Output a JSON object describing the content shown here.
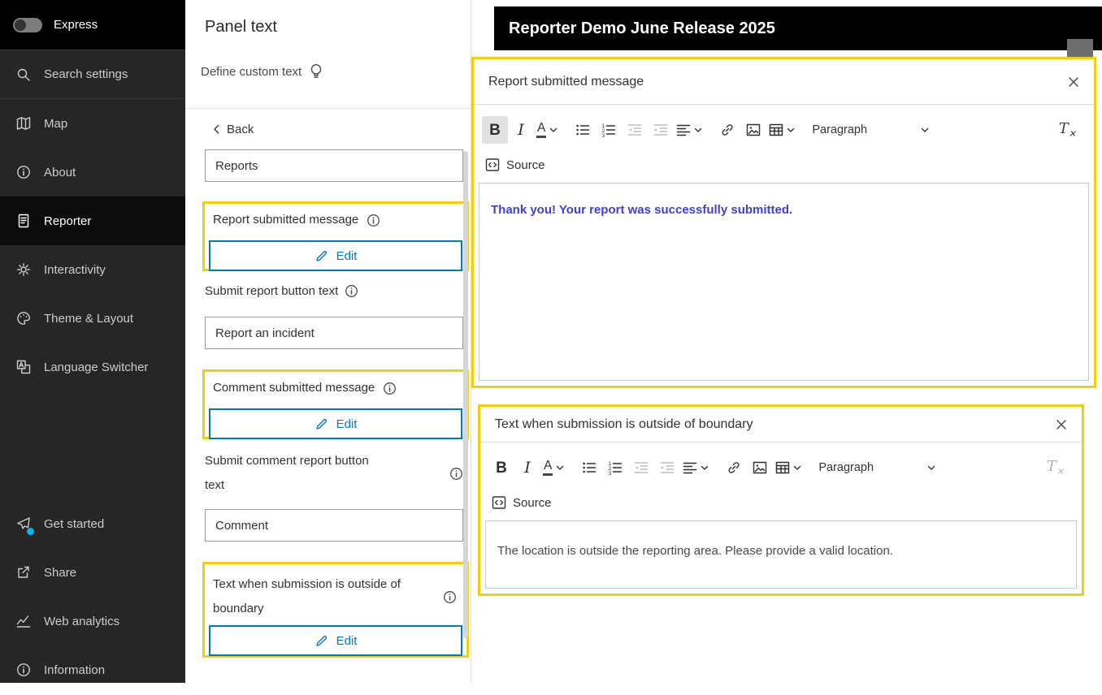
{
  "colors": {
    "highlight": "#F2CE0D",
    "accent": "#0079C1",
    "editor_message_blue": "#3F3FD6",
    "badge_blue": "#00B7F1"
  },
  "sidebar": {
    "express": {
      "label": "Express",
      "toggle_on": false
    },
    "items": [
      {
        "label": "Search settings",
        "icon": "search"
      },
      {
        "label": "Map",
        "icon": "map"
      },
      {
        "label": "About",
        "icon": "info"
      },
      {
        "label": "Reporter",
        "icon": "report",
        "selected": true
      },
      {
        "label": "Interactivity",
        "icon": "gear"
      },
      {
        "label": "Theme & Layout",
        "icon": "palette"
      },
      {
        "label": "Language Switcher",
        "icon": "language"
      }
    ],
    "footer_items": [
      {
        "label": "Get started",
        "icon": "paper-plane",
        "has_badge": true
      },
      {
        "label": "Share",
        "icon": "share"
      },
      {
        "label": "Web analytics",
        "icon": "line-chart"
      },
      {
        "label": "Information",
        "icon": "info"
      }
    ]
  },
  "panel": {
    "title": "Panel text",
    "subtitle": "Define custom text",
    "back_label": "Back",
    "fields": {
      "reports_value": "Reports",
      "report_submitted_label": "Report submitted message",
      "report_submitted_edit": "Edit",
      "submit_report_label": "Submit report button text",
      "submit_report_value": "Report an incident",
      "comment_submitted_label": "Comment submitted message",
      "comment_submitted_edit": "Edit",
      "submit_comment_label": "Submit comment report button text",
      "submit_comment_value": "Comment",
      "boundary_label": "Text when submission is outside of boundary",
      "boundary_edit": "Edit"
    }
  },
  "preview": {
    "header_title": "Reporter Demo June Release 2025"
  },
  "editor_toolbar": {
    "paragraph_label": "Paragraph",
    "source_label": "Source"
  },
  "dialogs": {
    "report_submitted": {
      "title": "Report submitted message",
      "content": "Thank you! Your report was successfully submitted."
    },
    "boundary": {
      "title": "Text when submission is outside of boundary",
      "content": "The location is outside the reporting area. Please provide a valid location."
    }
  }
}
